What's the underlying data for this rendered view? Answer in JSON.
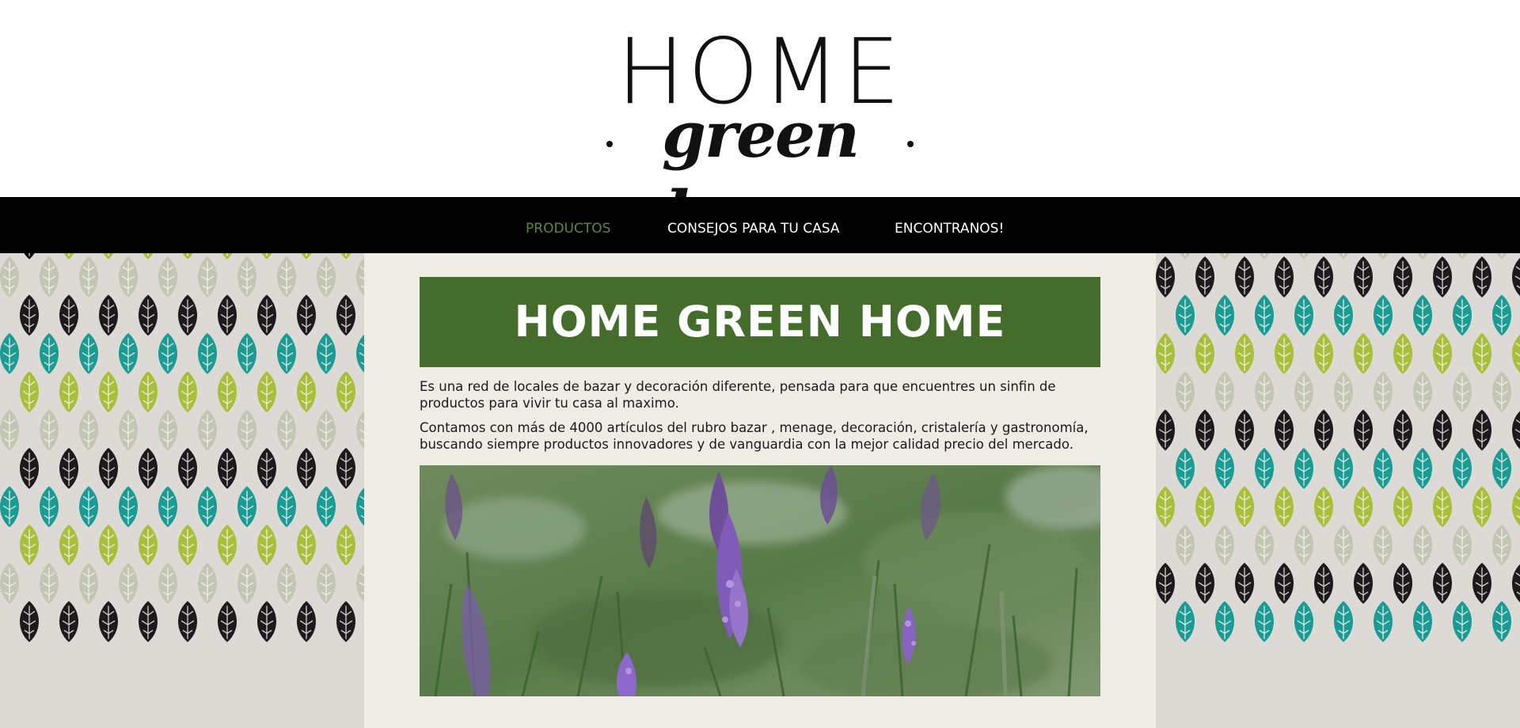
{
  "logo": {
    "word": "HOME",
    "script": "green home"
  },
  "nav": {
    "items": [
      {
        "label": "PRODUCTOS",
        "active": true
      },
      {
        "label": "CONSEJOS PARA TU CASA",
        "active": false
      },
      {
        "label": "ENCONTRANOS!",
        "active": false
      }
    ]
  },
  "main": {
    "banner_title": "HOME GREEN HOME",
    "paragraphs": [
      "Es una red de locales de bazar y decoración diferente, pensada para que encuentres un sinfin de productos para vivir tu casa al maximo.",
      "Contamos con más de 4000 artículos del rubro bazar , menage, decoración, cristalería y gastronomía, buscando siempre productos innovadores y de vanguardia con la mejor calidad precio del mercado."
    ],
    "photo_subject": "lavender-flowers"
  },
  "colors": {
    "nav_background": "#000000",
    "nav_active": "#5b8a32",
    "banner": "#446d2c",
    "content_background": "#efece6",
    "pattern_teal": "#1a9b94",
    "pattern_lime": "#a8bf3a",
    "pattern_sage": "#c2c6b2",
    "pattern_black": "#1c1a1c"
  }
}
